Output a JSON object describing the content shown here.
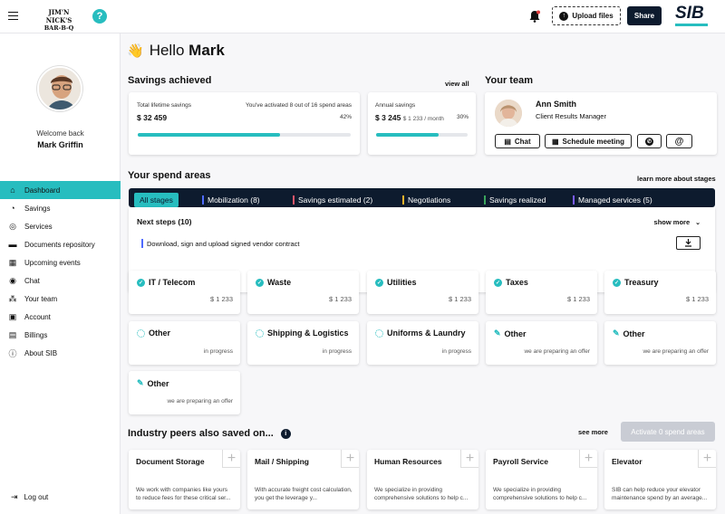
{
  "header": {
    "logo_line1": "JIM'N NICK'S",
    "logo_line2": "BAR-B-Q",
    "help_icon": "?",
    "upload_label": "Upload files",
    "share_label": "Share",
    "brand": "SIB"
  },
  "profile": {
    "welcome": "Welcome back",
    "name": "Mark Griffin"
  },
  "nav": [
    {
      "label": "Dashboard",
      "icon": "home-icon",
      "active": true
    },
    {
      "label": "Savings",
      "icon": "pie-icon"
    },
    {
      "label": "Services",
      "icon": "globe-icon"
    },
    {
      "label": "Documents repository",
      "icon": "folder-icon"
    },
    {
      "label": "Upcoming events",
      "icon": "calendar-icon"
    },
    {
      "label": "Chat",
      "icon": "chat-icon"
    },
    {
      "label": "Your team",
      "icon": "team-icon"
    },
    {
      "label": "Account",
      "icon": "account-icon"
    },
    {
      "label": "Billings",
      "icon": "billing-icon"
    },
    {
      "label": "About SIB",
      "icon": "info-icon"
    }
  ],
  "logout": "Log out",
  "greeting": {
    "emoji": "👋",
    "hello": "Hello",
    "name": "Mark"
  },
  "savings": {
    "title": "Savings achieved",
    "view_all": "view all",
    "lifetime": {
      "label": "Total lifetime savings",
      "value": "$ 32 459",
      "activated": "You've activated 8 out of 16 spend areas",
      "pct_text": "42%",
      "progress": 0.67
    },
    "annual": {
      "label": "Annual savings",
      "value": "$ 3 245",
      "sub": "$ 1 233 / month",
      "pct_text": "30%",
      "progress": 0.68
    }
  },
  "team": {
    "title": "Your team",
    "name": "Ann Smith",
    "role": "Client Results Manager",
    "chat": "Chat",
    "schedule": "Schedule meeting"
  },
  "spend": {
    "title": "Your spend areas",
    "learn": "learn more about stages",
    "stages": [
      {
        "label": "All stages",
        "color": "#27bdbf",
        "active": true
      },
      {
        "label": "Mobilization (8)",
        "color": "#4f6bff"
      },
      {
        "label": "Savings estimated (2)",
        "color": "#e0566a"
      },
      {
        "label": "Negotiations",
        "color": "#f1b32b"
      },
      {
        "label": "Savings realized",
        "color": "#3aa55d"
      },
      {
        "label": "Managed services (5)",
        "color": "#7b5cff"
      }
    ],
    "next_steps": "Next steps (10)",
    "show_more": "show more",
    "step_text": "Download, sign and upload signed vendor contract"
  },
  "tiles_row1": [
    {
      "title": "IT / Telecom",
      "value": "$ 1 233"
    },
    {
      "title": "Waste",
      "value": "$ 1 233"
    },
    {
      "title": "Utilities",
      "value": "$ 1 233"
    },
    {
      "title": "Taxes",
      "value": "$ 1 233"
    },
    {
      "title": "Treasury",
      "value": "$ 1 233"
    }
  ],
  "tiles_row2": [
    {
      "title": "Other",
      "status": "in progress",
      "icon": "progress-icon"
    },
    {
      "title": "Shipping & Logistics",
      "status": "in progress",
      "icon": "progress-icon"
    },
    {
      "title": "Uniforms & Laundry",
      "status": "in progress",
      "icon": "progress-icon"
    },
    {
      "title": "Other",
      "status": "we are preparing an offer",
      "icon": "pencil-icon"
    },
    {
      "title": "Other",
      "status": "we are preparing an offer",
      "icon": "pencil-icon"
    }
  ],
  "tiles_row3": [
    {
      "title": "Other",
      "status": "we are preparing an offer",
      "icon": "pencil-icon"
    }
  ],
  "peers": {
    "title": "Industry peers also saved on...",
    "see_more": "see more",
    "activate": "Activate 0 spend areas",
    "items": [
      {
        "title": "Document Storage",
        "desc": "We work with companies like yours to reduce fees for these critical ser..."
      },
      {
        "title": "Mail / Shipping",
        "desc": "With accurate freight cost calculation, you get the leverage y..."
      },
      {
        "title": "Human Resources",
        "desc": "We specialize in providing comprehensive solutions to help c..."
      },
      {
        "title": "Payroll Service",
        "desc": "We specialize in providing comprehensive solutions to help c..."
      },
      {
        "title": "Elevator",
        "desc": "SIB can help reduce your elevator maintenance spend by an average..."
      }
    ]
  }
}
